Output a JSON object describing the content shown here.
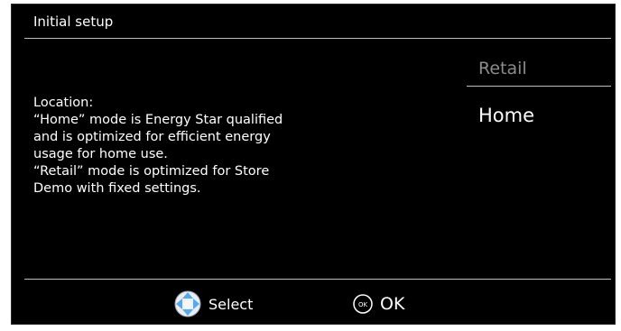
{
  "dialog": {
    "title": "Initial setup",
    "description": "Location:\n“Home” mode is Energy Star qualified\nand is optimized for efficient energy\nusage for home use.\n“Retail” mode is optimized for Store\nDemo with fixed settings."
  },
  "options": [
    {
      "label": "Retail",
      "state": "unselected"
    },
    {
      "label": "Home",
      "state": "highlighted"
    }
  ],
  "footer": {
    "select_label": "Select",
    "select_icon": "dpad-icon",
    "ok_label": "OK",
    "ok_icon": "ok-button-icon",
    "ok_icon_text": "OK"
  },
  "colors": {
    "background": "#000000",
    "text": "#ffffff",
    "dimmed_option": "#8c8c8c",
    "divider": "#bdbdbd",
    "dpad_blue": "#5aa9e6"
  }
}
